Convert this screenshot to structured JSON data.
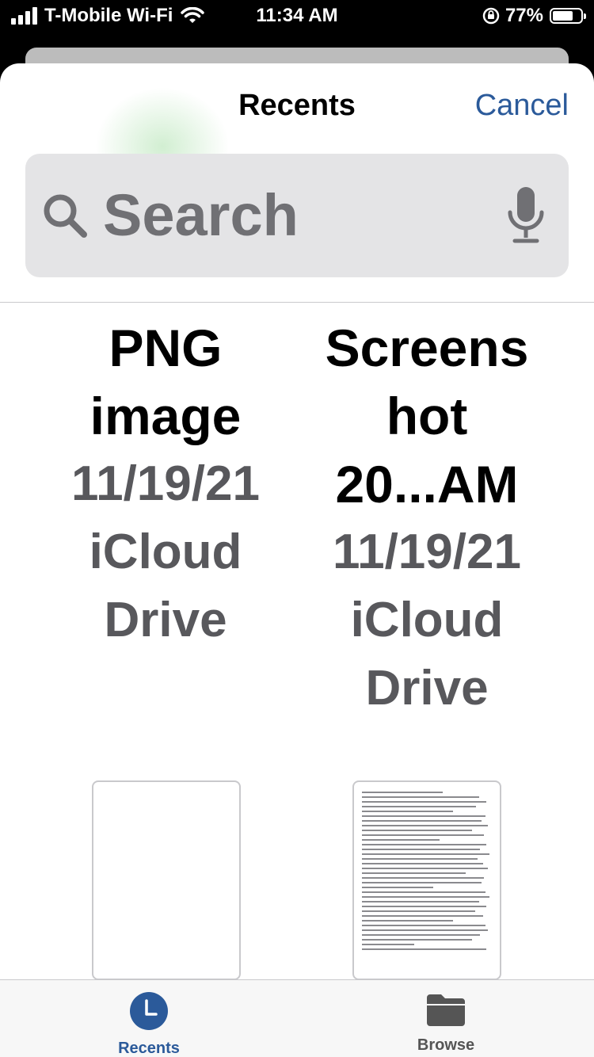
{
  "status_bar": {
    "carrier": "T-Mobile Wi-Fi",
    "time": "11:34 AM",
    "battery": "77%",
    "battery_level": 0.77
  },
  "header": {
    "title": "Recents",
    "cancel_label": "Cancel"
  },
  "search": {
    "placeholder": "Search",
    "icon": "search-icon",
    "mic_icon": "microphone-icon"
  },
  "files": [
    {
      "name_lines": [
        "PNG",
        "image"
      ],
      "date": "11/19/21",
      "location_lines": [
        "iCloud",
        "Drive"
      ]
    },
    {
      "name_lines": [
        "Screens",
        "hot",
        "20...AM"
      ],
      "date": "11/19/21",
      "location_lines": [
        "iCloud",
        "Drive"
      ]
    }
  ],
  "tabs": [
    {
      "label": "Recents",
      "icon": "clock-icon",
      "selected": true
    },
    {
      "label": "Browse",
      "icon": "folder-icon",
      "selected": false
    }
  ],
  "colors": {
    "accent": "#2b5a9a",
    "secondary_text": "#58585c"
  }
}
